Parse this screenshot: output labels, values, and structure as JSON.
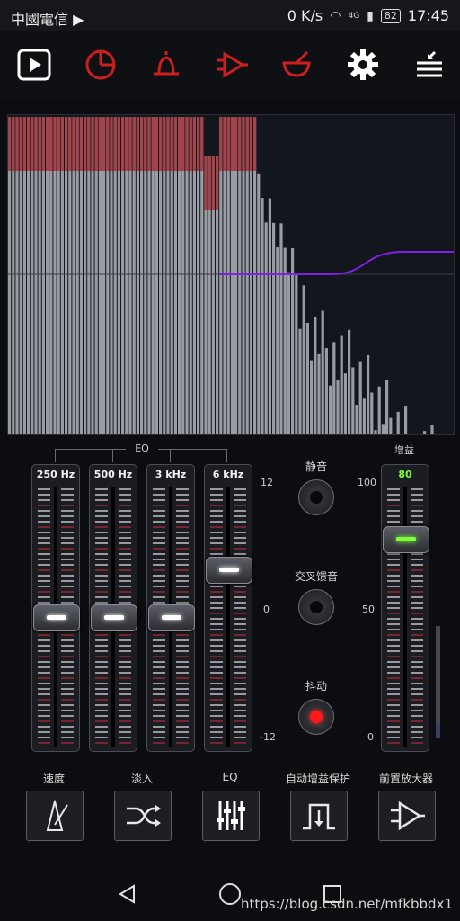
{
  "status_bar": {
    "carrier": "中國電信 ▶",
    "speed": "0 K/s",
    "network": "4G",
    "battery": "82",
    "time": "17:45"
  },
  "toolbar": {
    "icons": [
      "play-screen-icon",
      "timer-icon",
      "bell-icon",
      "amplifier-icon",
      "mortar-icon",
      "gear-icon",
      "menu-collapse-icon"
    ],
    "accent_color": "#cc1f1f"
  },
  "spectrum": {
    "bar_color": "#9a9ca3",
    "peak_color": "#a8242c",
    "curve_color": "#7d22e8"
  },
  "eq": {
    "title": "EQ",
    "bands": [
      {
        "label": "250 Hz",
        "level": 0
      },
      {
        "label": "500 Hz",
        "level": 0
      },
      {
        "label": "3 kHz",
        "level": 0
      },
      {
        "label": "6 kHz",
        "level": 4.4
      }
    ],
    "scale_top": "12",
    "scale_mid": "0",
    "scale_bottom": "-12"
  },
  "controls": {
    "mute_label": "静音",
    "crossfeed_label": "交叉馈音",
    "dither_label": "抖动"
  },
  "gain": {
    "title": "增益",
    "value": "80",
    "level": 80,
    "scale_top": "100",
    "scale_mid": "50",
    "scale_bottom": "0"
  },
  "bottom": {
    "speed_label": "速度",
    "fade_label": "淡入",
    "eq_label": "EQ",
    "agc_label": "自动增益保护",
    "preamp_label": "前置放大器"
  },
  "watermark": "https://blog.csdn.net/mfkbbdx1"
}
